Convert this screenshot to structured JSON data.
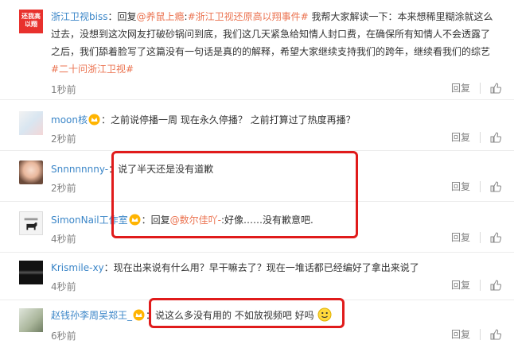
{
  "comments": [
    {
      "user": "浙江卫视biss",
      "sep": "：",
      "text_parts": [
        "回复",
        "@养鼠上瘾",
        ":",
        "#浙江卫视还原高以翔事件#",
        " 我帮大家解读一下：本来想稀里糊涂就这么过去，没想到这次网友打破砂锅问到底，我们这几天紧急给知情人封口费，在确保所有知情人不会透露了之后，我们舔着脸写了这篇没有一句话是真的的解释，希望大家继续支持我们的跨年，继续看我们的综艺",
        "#二十问浙江卫视#"
      ],
      "time": "1秒前",
      "avatar_text": "还我高以翔"
    },
    {
      "user": "moon核",
      "sep": "：",
      "text": "之前说停播一周 现在永久停播？ 之前打算过了热度再播？",
      "time": "2秒前"
    },
    {
      "user": "Snnnnnnny-",
      "sep": "：",
      "text": "说了半天还是没有道歉",
      "time": "2秒前"
    },
    {
      "user": "SimonNail工作室",
      "sep": "：",
      "reply_prefix": "回复",
      "reply_to": "@数尔佳吖-",
      "text": ":好像……没有歉意吧.",
      "time": "4秒前"
    },
    {
      "user": "Krismile-xy",
      "sep": "：",
      "text": "现在出来说有什么用？早干嘛去了？现在一堆话都已经编好了拿出来说了",
      "time": "4秒前"
    },
    {
      "user": "赵钱孙李周吴郑王_",
      "sep": "：",
      "text": "说这么多没有用的 不如放视频吧 好吗",
      "time": "6秒前"
    }
  ],
  "actions": {
    "reply_label": "回复"
  },
  "colors": {
    "username": "#eb7350",
    "highlight_box": "#e01b1b",
    "link": "#eb7350"
  },
  "icons": [
    "thumbs-up-icon",
    "crown-badge-icon",
    "smile-emoji-icon"
  ]
}
